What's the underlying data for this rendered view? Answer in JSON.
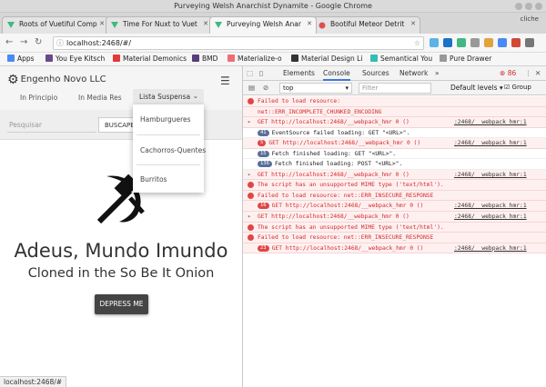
{
  "window": {
    "title": "Purveying Welsh Anarchist Dynamite - Google Chrome"
  },
  "tabs": [
    {
      "label": "Roots of Vuetiful Comp",
      "active": false,
      "fav_color": "#41b883"
    },
    {
      "label": "Time For Nuxt to Vuet",
      "active": false,
      "fav_color": "#41b883"
    },
    {
      "label": "Purveying Welsh Anar",
      "active": true,
      "fav_color": "#41b883"
    },
    {
      "label": "Bootiful Meteor Detrit",
      "active": false,
      "fav_color": "#de4f4f"
    }
  ],
  "profile": "cliche",
  "address": {
    "url": "localhost:2468/#/"
  },
  "bookmarks": [
    {
      "label": "Apps",
      "color": "#4a8af4"
    },
    {
      "label": "You Eye Kitsch",
      "color": "#6a4a8a"
    },
    {
      "label": "Material Demonics",
      "color": "#e53935"
    },
    {
      "label": "BMD",
      "color": "#563d7c"
    },
    {
      "label": "Materialize-o",
      "color": "#ee6e73"
    },
    {
      "label": "Material Design Li",
      "color": "#333333"
    },
    {
      "label": "Semantical You",
      "color": "#35bdb2"
    },
    {
      "label": "Pure Drawer",
      "color": "#999999"
    }
  ],
  "app": {
    "brand": "Engenho Novo LLC",
    "nav": [
      "In Principio",
      "In Media Res",
      "Lista Suspensa"
    ],
    "search_placeholder": "Pesquisar",
    "search_button": "BUSCAPE",
    "dropdown": [
      "Hamburgueres",
      "Cachorros-Quentes",
      "Burritos"
    ],
    "heading": "Adeus, Mundo Imundo",
    "subheading": "Cloned in the So Be It Onion",
    "button": "DEPRESS ME"
  },
  "status_url": "localhost:2468/#",
  "devtools": {
    "tabs": [
      "Elements",
      "Console",
      "Sources",
      "Network",
      "»"
    ],
    "error_count": "86",
    "context": "top",
    "filter_placeholder": "Filter",
    "levels": "Default levels ▾",
    "group_similar": "Group similar",
    "logs": [
      {
        "type": "err",
        "text": "Failed to load resource: ",
        "src": ""
      },
      {
        "type": "err",
        "text": "net::ERR_INCOMPLETE_CHUNKED_ENCODING",
        "src": ""
      },
      {
        "type": "err",
        "text": "GET http://localhost:2468/__webpack_hmr 0 ()",
        "src": ":2468/__webpack_hmr:1"
      },
      {
        "type": "info",
        "badge": "41",
        "text": "EventSource failed loading: GET \"<URL>\".",
        "src": ""
      },
      {
        "type": "err",
        "badge": "5",
        "text": "GET http://localhost:2468/__webpack_hmr 0 ()",
        "src": ":2468/__webpack_hmr:1"
      },
      {
        "type": "info",
        "badge": "15",
        "text": "Fetch finished loading: GET \"<URL>\".",
        "src": ""
      },
      {
        "type": "info",
        "badge": "136",
        "text": "Fetch finished loading: POST \"<URL>\".",
        "src": ""
      },
      {
        "type": "err",
        "text": "GET http://localhost:2468/__webpack_hmr 0 ()",
        "src": ":2468/__webpack_hmr:1"
      },
      {
        "type": "err",
        "text": "The script has an unsupported MIME type ('text/html').",
        "src": ""
      },
      {
        "type": "err",
        "text": "Failed to load resource: net::ERR_INSECURE_RESPONSE",
        "src": ""
      },
      {
        "type": "err",
        "badge": "16",
        "text": "GET http://localhost:2468/__webpack_hmr 0 ()",
        "src": ":2468/__webpack_hmr:1"
      },
      {
        "type": "err",
        "text": "GET http://localhost:2468/__webpack_hmr 0 ()",
        "src": ":2468/__webpack_hmr:1"
      },
      {
        "type": "err",
        "text": "The script has an unsupported MIME type ('text/html').",
        "src": ""
      },
      {
        "type": "err",
        "text": "Failed to load resource: net::ERR_INSECURE_RESPONSE",
        "src": ""
      },
      {
        "type": "err",
        "badge": "23",
        "text": "GET http://localhost:2468/__webpack_hmr 0 ()",
        "src": ":2468/__webpack_hmr:1"
      }
    ]
  }
}
